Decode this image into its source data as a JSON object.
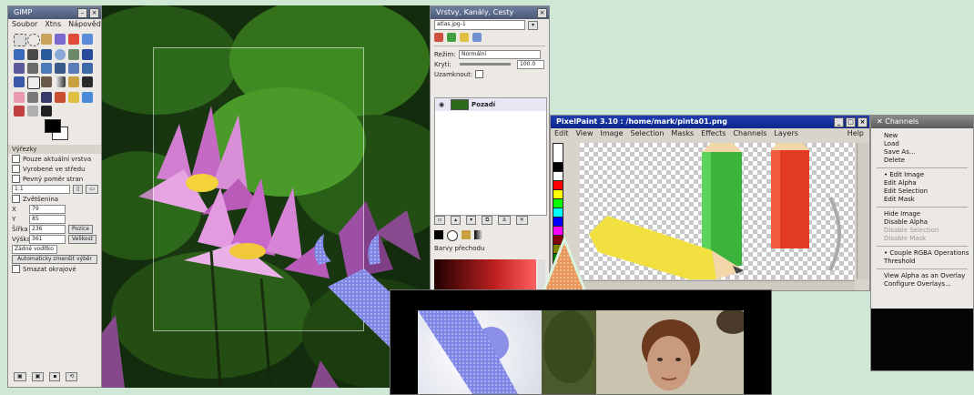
{
  "toolbox": {
    "title": "GIMP",
    "menu": [
      "Soubor",
      "Xtns",
      "Nápověda"
    ],
    "options_title": "Výřezky",
    "options": {
      "cb1": "Pouze aktuální vrstva",
      "cb2": "Vyrobené ve středu",
      "cb3": "Pevný poměr stran",
      "ratio_value": "1:1",
      "cb_zoom": "Zvětšenina",
      "x_label": "X",
      "x_value": "79",
      "y_label": "Y",
      "y_value": "85",
      "w_label": "Šířka",
      "w_value": "236",
      "h_label": "Výška",
      "h_value": "361",
      "pos_button": "Pozice",
      "size_button": "Velikost",
      "select_value": "Žádné vodítko",
      "auto_button": "Automaticky zmenšit výběr",
      "last_check": "Smazat okrajové"
    },
    "bottom_icons": [
      "save-options-icon",
      "restore-options-icon",
      "delete-options-icon",
      "reset-options-icon"
    ]
  },
  "layers_dialog": {
    "title": "Vrstvy, Kanály, Cesty",
    "image_select": "atlas.jpg-1",
    "mode_label": "Režim:",
    "mode_value": "Normální",
    "opacity_label": "Krytí:",
    "opacity_value": "100.0",
    "lock_label": "Uzamknout:",
    "layer_name": "Pozadí",
    "gradient_panel_title": "Barvy přechodu"
  },
  "pinta": {
    "title": "PixelPaint 3.10 : /home/mark/pinta01.png",
    "menu": [
      "Edit",
      "View",
      "Image",
      "Selection",
      "Masks",
      "Effects",
      "Channels",
      "Layers",
      "Help"
    ],
    "palette": [
      "#000000",
      "#ffffff",
      "#ff0000",
      "#ffff00",
      "#00ff00",
      "#00ffff",
      "#0000ff",
      "#ff00ff",
      "#800000",
      "#808000",
      "#008000",
      "#008080"
    ]
  },
  "channels_menu": {
    "title": "Channels",
    "items": [
      {
        "label": "New",
        "dim": false
      },
      {
        "label": "Load",
        "dim": false
      },
      {
        "label": "Save As...",
        "dim": false
      },
      {
        "label": "Delete",
        "dim": false
      },
      {
        "sep": true
      },
      {
        "label": "• Edit Image",
        "dim": false
      },
      {
        "label": "Edit Alpha",
        "dim": false
      },
      {
        "label": "Edit Selection",
        "dim": false
      },
      {
        "label": "Edit Mask",
        "dim": false
      },
      {
        "sep": true
      },
      {
        "label": "Hide Image",
        "dim": false
      },
      {
        "label": "Disable Alpha",
        "dim": false
      },
      {
        "label": "Disable Selection",
        "dim": true
      },
      {
        "label": "Disable Mask",
        "dim": true
      },
      {
        "sep": true
      },
      {
        "label": "• Couple RGBA Operations",
        "dim": false
      },
      {
        "label": "Threshold",
        "dim": false
      },
      {
        "sep": true
      },
      {
        "label": "View Alpha as an Overlay",
        "dim": false
      },
      {
        "label": "Configure Overlays...",
        "dim": false
      }
    ]
  },
  "colors": {
    "toolbox_bg": "#ece9e4",
    "pinta_title": "#1f3fb0",
    "page_bg": "#cfe8d5",
    "logo_blue": "#8b8fe8",
    "logo_orange": "#f0a36a"
  }
}
